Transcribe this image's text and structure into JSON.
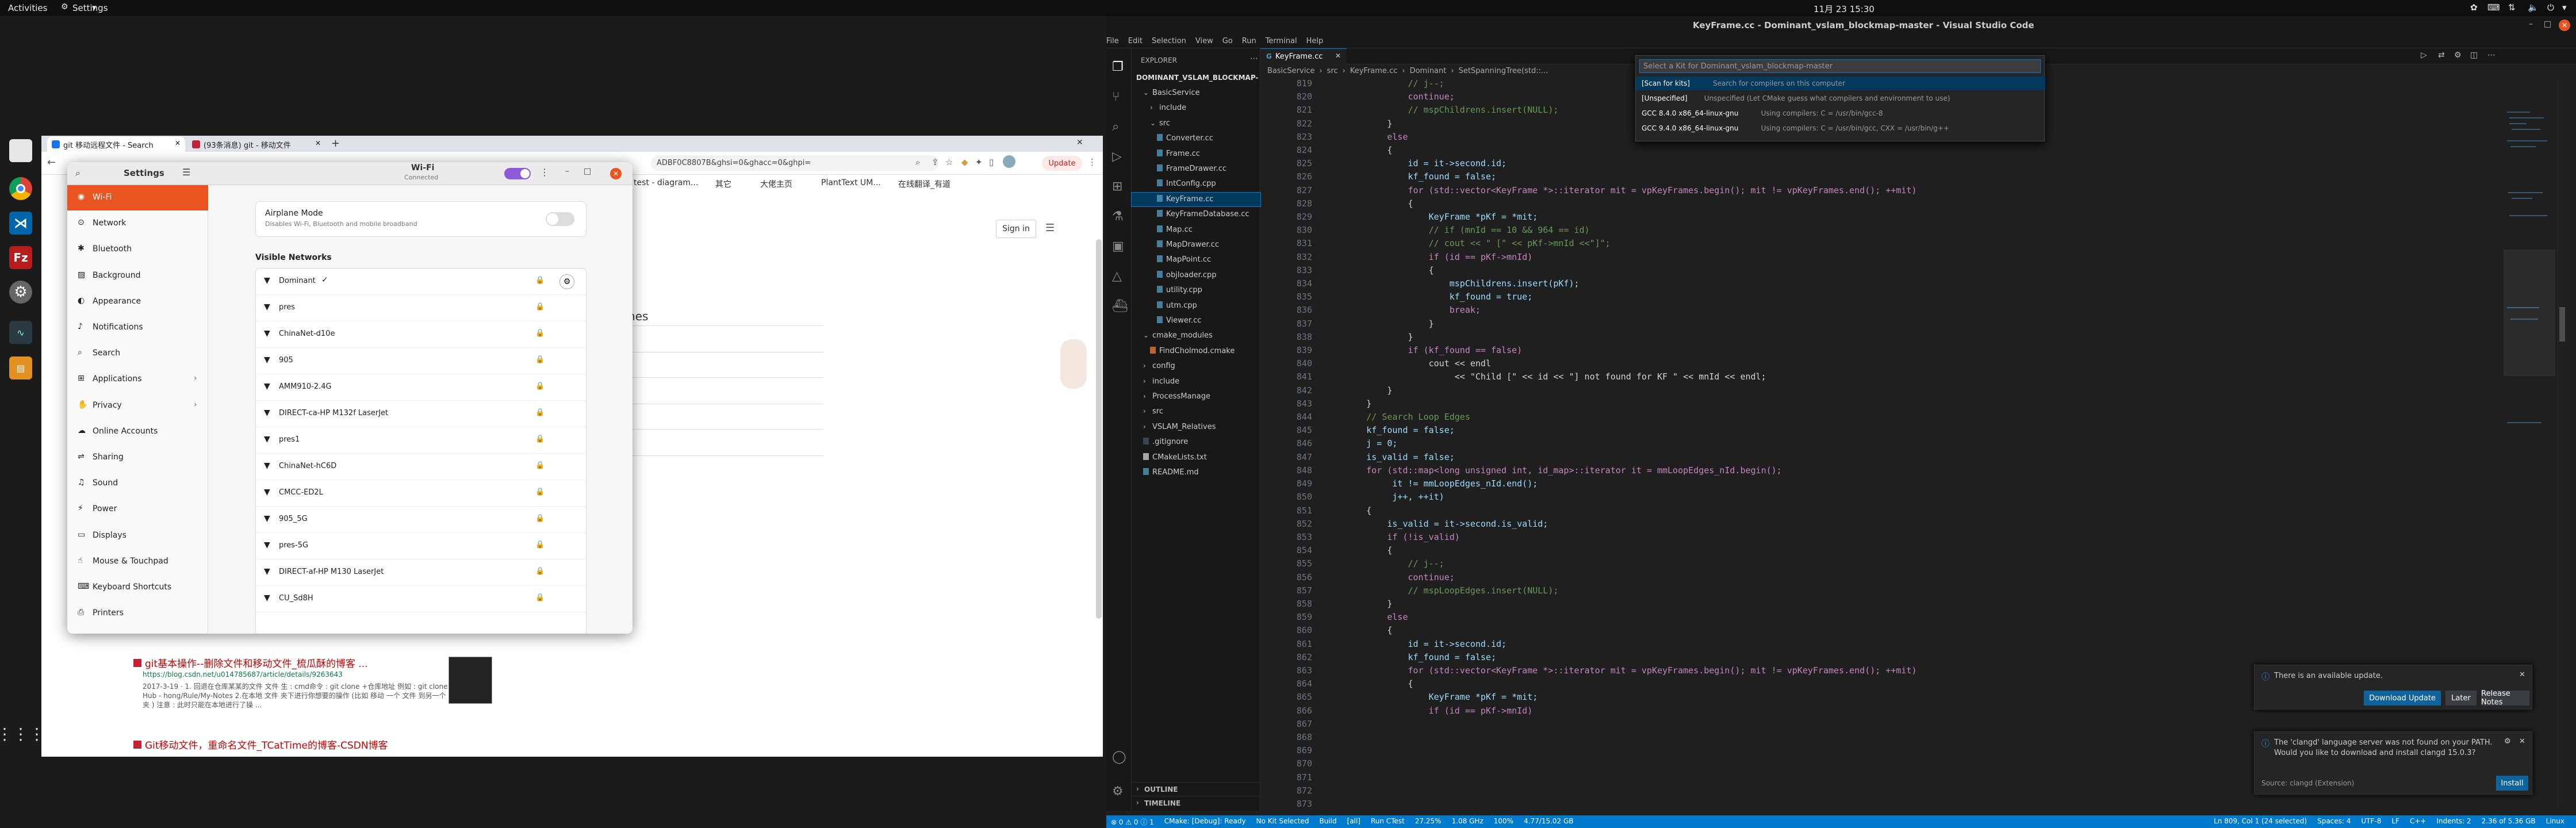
{
  "topbar": {
    "activities": "Activities",
    "app": "Settings",
    "clock": "11月 23  15:30"
  },
  "browser": {
    "tabs": [
      "git 移动远程文件 - Search",
      "(93条消息) git - 移动文件"
    ],
    "address": "ADBF0C8807B&ghsi=0&ghacc=0&ghpi=",
    "update_label": "Update",
    "bookmarks": [
      "test - diagram...",
      "其它",
      "大佬主页",
      "PlantText UM...",
      "在线翻译_有道"
    ],
    "sign_in": "Sign in",
    "partial_heading": "hes",
    "results": [
      {
        "title": "git基本操作--删除文件和移动文件_梳瓜酥的博客 ...",
        "url": "https://blog.csdn.net/u014785687/article/details/9263643",
        "date_snip": "2017-3-19 · 1. 回退在仓库某某的文件 文件 生 : cmd命令 : git clone +仓库地址 例如 : git clone Git Hub - hong/Rule/My-Notes 2.在本地 文件 夹下进行你想要的操作 (比如 移动 一个 文件 到另一个 文件 夹 ) 注意 : 此时只能在本地进行了操 ..."
      },
      {
        "title": "Git移动文件，重命名文件_TCatTime的博客-CSDN博客"
      }
    ]
  },
  "settings": {
    "title": "Settings",
    "panel_title": "Wi-Fi",
    "panel_status": "Connected",
    "sidebar": [
      "Wi-Fi",
      "Network",
      "Bluetooth",
      "Background",
      "Appearance",
      "Notifications",
      "Search",
      "Applications",
      "Privacy",
      "Online Accounts",
      "Sharing",
      "Sound",
      "Power",
      "Displays",
      "Mouse & Touchpad",
      "Keyboard Shortcuts",
      "Printers"
    ],
    "airplane_title": "Airplane Mode",
    "airplane_desc": "Disables Wi-Fi, Bluetooth and mobile broadband",
    "visible_networks_label": "Visible Networks",
    "networks": [
      "Dominant",
      "pres",
      "ChinaNet-d10e",
      "905",
      "AMM910-2.4G",
      "DIRECT-ca-HP M132f LaserJet",
      "pres1",
      "ChinaNet-hC6D",
      "CMCC-ED2L",
      "905_5G",
      "pres-5G",
      "DIRECT-af-HP M130 LaserJet",
      "CU_Sd8H"
    ]
  },
  "vscode": {
    "window_title": "KeyFrame.cc - Dominant_vslam_blockmap-master - Visual Studio Code",
    "menu": [
      "File",
      "Edit",
      "Selection",
      "View",
      "Go",
      "Run",
      "Terminal",
      "Help"
    ],
    "explorer_label": "EXPLORER",
    "root_folder": "DOMINANT_VSLAM_BLOCKMAP-MAST...",
    "tree": [
      {
        "name": "BasicService",
        "depth": 1,
        "kind": "folder-open"
      },
      {
        "name": "include",
        "depth": 2,
        "kind": "folder"
      },
      {
        "name": "src",
        "depth": 2,
        "kind": "folder-open"
      },
      {
        "name": "Converter.cc",
        "depth": 3,
        "kind": "file"
      },
      {
        "name": "Frame.cc",
        "depth": 3,
        "kind": "file"
      },
      {
        "name": "FrameDrawer.cc",
        "depth": 3,
        "kind": "file"
      },
      {
        "name": "IntConfig.cpp",
        "depth": 3,
        "kind": "file"
      },
      {
        "name": "KeyFrame.cc",
        "depth": 3,
        "kind": "file",
        "selected": true
      },
      {
        "name": "KeyFrameDatabase.cc",
        "depth": 3,
        "kind": "file"
      },
      {
        "name": "Map.cc",
        "depth": 3,
        "kind": "file"
      },
      {
        "name": "MapDrawer.cc",
        "depth": 3,
        "kind": "file"
      },
      {
        "name": "MapPoint.cc",
        "depth": 3,
        "kind": "file"
      },
      {
        "name": "objloader.cpp",
        "depth": 3,
        "kind": "file"
      },
      {
        "name": "utility.cpp",
        "depth": 3,
        "kind": "file"
      },
      {
        "name": "utm.cpp",
        "depth": 3,
        "kind": "file"
      },
      {
        "name": "Viewer.cc",
        "depth": 3,
        "kind": "file"
      },
      {
        "name": "cmake_modules",
        "depth": 1,
        "kind": "folder-open"
      },
      {
        "name": "FindCholmod.cmake",
        "depth": 2,
        "kind": "file"
      },
      {
        "name": "config",
        "depth": 1,
        "kind": "folder"
      },
      {
        "name": "include",
        "depth": 1,
        "kind": "folder"
      },
      {
        "name": "ProcessManage",
        "depth": 1,
        "kind": "folder"
      },
      {
        "name": "src",
        "depth": 1,
        "kind": "folder"
      },
      {
        "name": "VSLAM_Relatives",
        "depth": 1,
        "kind": "folder"
      },
      {
        "name": ".gitignore",
        "depth": 1,
        "kind": "file"
      },
      {
        "name": "CMakeLists.txt",
        "depth": 1,
        "kind": "file"
      },
      {
        "name": "README.md",
        "depth": 1,
        "kind": "file"
      }
    ],
    "outline_label": "OUTLINE",
    "timeline_label": "TIMELINE",
    "tab_label": "KeyFrame.cc",
    "breadcrumb": [
      "BasicService",
      "src",
      "KeyFrame.cc",
      "Dominant",
      "SetSpanningTree(std::..."
    ],
    "kit_placeholder": "Select a Kit for Dominant_vslam_blockmap-master",
    "kit_options": [
      {
        "label": "[Scan for kits]",
        "desc": "Search for compilers on this computer"
      },
      {
        "label": "[Unspecified]",
        "desc": "Unspecified (Let CMake guess what compilers and environment to use)"
      },
      {
        "label": "GCC 8.4.0 x86_64-linux-gnu",
        "desc": "Using compilers: C = /usr/bin/gcc-8"
      },
      {
        "label": "GCC 9.4.0 x86_64-linux-gnu",
        "desc": "Using compilers: C = /usr/bin/gcc, CXX = /usr/bin/g++"
      }
    ],
    "line_start": 819,
    "code_lines": [
      "                // j--;",
      "                continue;",
      "                // mspChildrens.insert(NULL);",
      "            }",
      "",
      "            else",
      "            {",
      "                id = it->second.id;",
      "",
      "                kf_found = false;",
      "                for (std::vector<KeyFrame *>::iterator mit = vpKeyFrames.begin(); mit != vpKeyFrames.end(); ++mit)",
      "                {",
      "                    KeyFrame *pKf = *mit;",
      "                    // if (mnId == 10 && 964 == id)",
      "                    // cout << \" [\" << pKf->mnId <<\"]\";",
      "                    if (id == pKf->mnId)",
      "                    {",
      "                        mspChildrens.insert(pKf);",
      "                        kf_found = true;",
      "                        break;",
      "                    }",
      "                }",
      "                if (kf_found == false)",
      "                    cout << endl",
      "                         << \"Child [\" << id << \"] not found for KF \" << mnId << endl;",
      "            }",
      "        }",
      "",
      "        // Search Loop Edges",
      "        kf_found = false;",
      "        j = 0;",
      "        is_valid = false;",
      "        for (std::map<long unsigned int, id_map>::iterator it = mmLoopEdges_nId.begin();",
      "             it != mmLoopEdges_nId.end();",
      "             j++, ++it)",
      "        {",
      "            is_valid = it->second.is_valid;",
      "",
      "            if (!is_valid)",
      "            {",
      "                // j--;",
      "                continue;",
      "                // mspLoopEdges.insert(NULL);",
      "            }",
      "",
      "            else",
      "            {",
      "                id = it->second.id;",
      "",
      "                kf_found = false;",
      "                for (std::vector<KeyFrame *>::iterator mit = vpKeyFrames.begin(); mit != vpKeyFrames.end(); ++mit)",
      "                {",
      "                    KeyFrame *pKf = *mit;",
      "",
      "                    if (id == pKf->mnId)"
    ],
    "notifications": [
      {
        "text": "There is an available update.",
        "buttons": [
          "Download Update",
          "Later",
          "Release Notes"
        ]
      },
      {
        "text": "The 'clangd' language server was not found on your PATH. Would you like to download and install clangd 15.0.3?",
        "source": "Source: clangd (Extension)",
        "buttons": [
          "Install"
        ]
      }
    ],
    "status_left": [
      "⊗ 0 ⚠ 0 ⓘ 1",
      "CMake: [Debug]: Ready",
      "No Kit Selected",
      "Build",
      "[all]",
      "Run CTest",
      "27.25%",
      "1.08 GHz",
      "100%",
      "4.77/15.02 GB"
    ],
    "status_right": [
      "Ln 809, Col 1 (24 selected)",
      "Spaces: 4",
      "UTF-8",
      "LF",
      "C++",
      "Indents: 2",
      "2.36 of 5.36 GB",
      "Linux"
    ],
    "colors": {
      "statusbar": "#007acc",
      "accent": "#0e639c",
      "bg": "#1f1f1f"
    }
  }
}
